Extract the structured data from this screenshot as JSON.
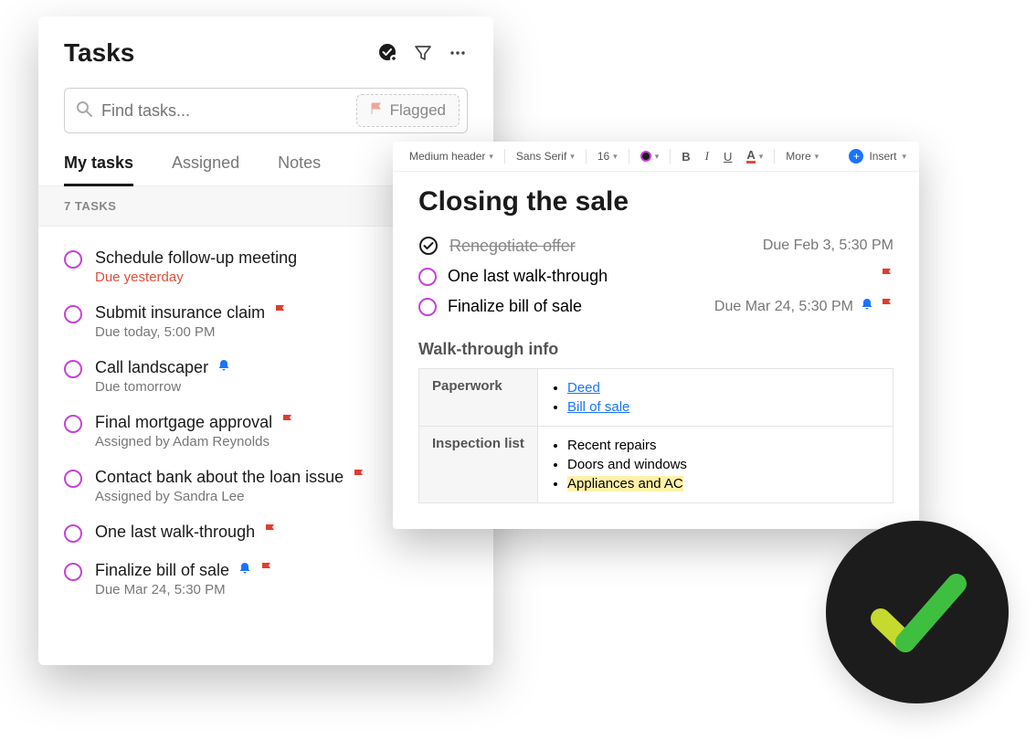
{
  "tasks_panel": {
    "title": "Tasks",
    "search_placeholder": "Find tasks...",
    "flagged_chip": "Flagged",
    "tabs": {
      "my_tasks": "My tasks",
      "assigned": "Assigned",
      "notes": "Notes"
    },
    "count_label": "7 TASKS",
    "items": [
      {
        "title": "Schedule follow-up meeting",
        "sub": "Due yesterday",
        "sub_red": true
      },
      {
        "title": "Submit insurance claim",
        "sub": "Due today, 5:00 PM",
        "flag": true
      },
      {
        "title": "Call landscaper",
        "sub": "Due tomorrow",
        "bell": true
      },
      {
        "title": "Final mortgage approval",
        "sub": "Assigned by Adam Reynolds",
        "flag": true
      },
      {
        "title": "Contact bank about the loan issue",
        "sub": "Assigned by Sandra Lee",
        "flag": true
      },
      {
        "title": "One last walk-through",
        "flag": true
      },
      {
        "title": "Finalize bill of sale",
        "sub": "Due Mar 24, 5:30 PM",
        "bell": true,
        "flag": true
      }
    ]
  },
  "note_panel": {
    "toolbar": {
      "heading": "Medium header",
      "font": "Sans Serif",
      "size": "16",
      "more": "More",
      "insert": "Insert"
    },
    "title": "Closing the sale",
    "tasks": [
      {
        "title": "Renegotiate offer",
        "done": true,
        "due": "Due Feb 3, 5:30 PM"
      },
      {
        "title": "One last walk-through",
        "flag": true
      },
      {
        "title": "Finalize bill of sale",
        "due": "Due Mar 24, 5:30 PM",
        "bell": true,
        "flag": true
      }
    ],
    "section": "Walk-through info",
    "table": {
      "rows": [
        {
          "header": "Paperwork",
          "links": [
            "Deed",
            "Bill of sale"
          ]
        },
        {
          "header": "Inspection list",
          "items": [
            "Recent repairs",
            "Doors and windows",
            "Appliances and AC"
          ],
          "highlight_index": 2
        }
      ]
    }
  }
}
